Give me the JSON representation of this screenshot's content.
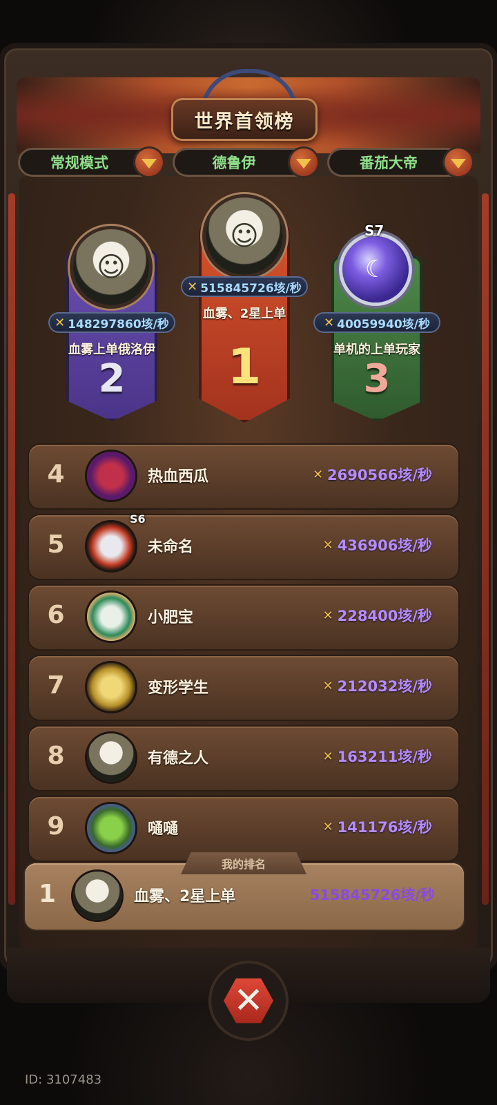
{
  "title": "世界首领榜",
  "filters": [
    {
      "label": "常规模式"
    },
    {
      "label": "德鲁伊"
    },
    {
      "label": "番茄大帝"
    }
  ],
  "podium": {
    "first": {
      "rank": "1",
      "name": "血雾、2星上单",
      "score": "515845726垓/秒"
    },
    "second": {
      "rank": "2",
      "name": "血雾上单俄洛伊",
      "score": "148297860垓/秒"
    },
    "third": {
      "rank": "3",
      "name": "单机的上单玩家",
      "score": "40059940垓/秒",
      "season": "S7"
    }
  },
  "list": [
    {
      "rank": "4",
      "name": "热血西瓜",
      "score": "2690566垓/秒",
      "avatar_color": "#7a2a8a"
    },
    {
      "rank": "5",
      "name": "未命名",
      "score": "436906垓/秒",
      "avatar_color": "#b83a24",
      "season": "S6"
    },
    {
      "rank": "6",
      "name": "小肥宝",
      "score": "228400垓/秒",
      "avatar_color": "#3a8a5a"
    },
    {
      "rank": "7",
      "name": "变形学生",
      "score": "212032垓/秒",
      "avatar_color": "#b89a3a"
    },
    {
      "rank": "8",
      "name": "有德之人",
      "score": "163211垓/秒",
      "avatar_color": "#7a745e"
    },
    {
      "rank": "9",
      "name": "嗵嗵",
      "score": "141176垓/秒",
      "avatar_color": "#4a8a2a"
    }
  ],
  "my_rank": {
    "tag": "我的排名",
    "rank": "1",
    "name": "血雾、2星上单",
    "score": "515845726垓/秒"
  },
  "footer": {
    "id": "ID: 3107483"
  },
  "icons": {
    "sword": "crossed-swords-icon",
    "close": "close-icon",
    "dropdown": "chevron-down-icon"
  }
}
